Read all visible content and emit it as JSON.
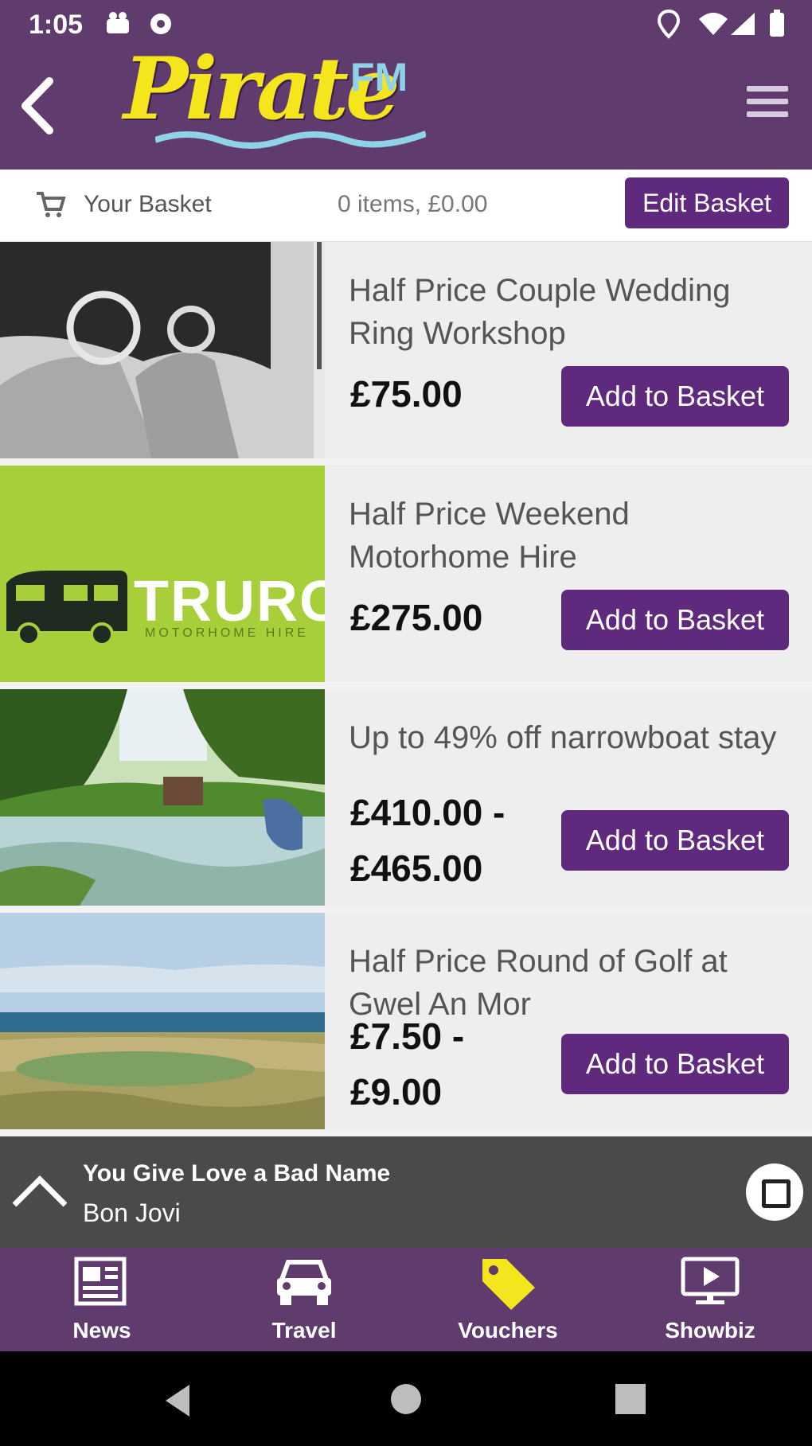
{
  "status_bar": {
    "time": "1:05"
  },
  "app": {
    "logo_text": "Pirate",
    "logo_fm": "FM"
  },
  "basket": {
    "label": "Your Basket",
    "summary": "0 items, £0.00",
    "edit_label": "Edit Basket"
  },
  "vouchers": [
    {
      "title": "Half Price Couple Wedding Ring Workshop",
      "price": "£75.00",
      "add_label": "Add to Basket"
    },
    {
      "title": "Half Price Weekend Motorhome Hire",
      "price": "£275.00",
      "add_label": "Add to Basket",
      "image_text": "TRURO",
      "image_subtext": "MOTORHOME HIRE"
    },
    {
      "title": "Up to 49% off narrowboat stay",
      "price_from": "£410.00 -",
      "price_to": "£465.00",
      "add_label": "Add to Basket"
    },
    {
      "title": "Half Price Round of Golf at Gwel An Mor",
      "price_from": "£7.50 -",
      "price_to": "£9.00",
      "add_label": "Add to Basket"
    }
  ],
  "player": {
    "song": "You Give Love a Bad Name",
    "artist": "Bon Jovi"
  },
  "nav": [
    {
      "label": "News",
      "icon": "newspaper-icon"
    },
    {
      "label": "Travel",
      "icon": "car-icon"
    },
    {
      "label": "Vouchers",
      "icon": "tag-icon",
      "active": true
    },
    {
      "label": "Showbiz",
      "icon": "tv-icon"
    }
  ],
  "colors": {
    "header": "#5f3b6e",
    "button": "#5f2a7d",
    "logo_yellow": "#f5e51c",
    "active_nav": "#f5e51c"
  }
}
